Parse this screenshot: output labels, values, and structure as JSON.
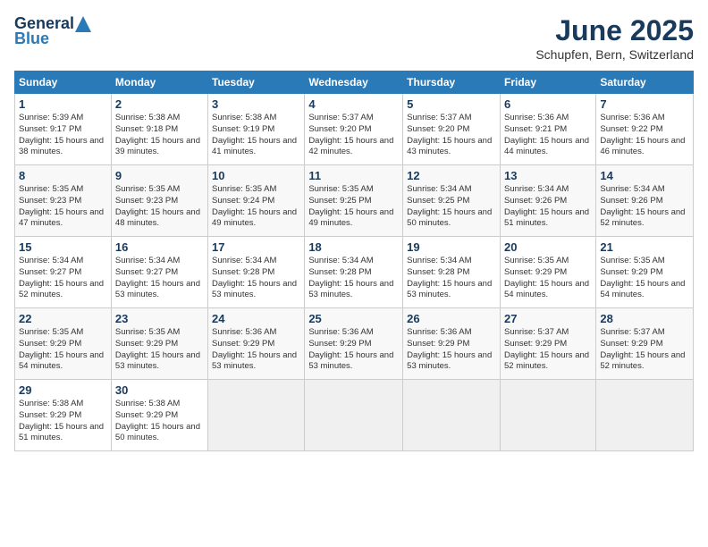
{
  "logo": {
    "general": "General",
    "blue": "Blue"
  },
  "title": "June 2025",
  "location": "Schupfen, Bern, Switzerland",
  "headers": [
    "Sunday",
    "Monday",
    "Tuesday",
    "Wednesday",
    "Thursday",
    "Friday",
    "Saturday"
  ],
  "weeks": [
    [
      {
        "day": "1",
        "sunrise": "5:39 AM",
        "sunset": "9:17 PM",
        "daylight": "15 hours and 38 minutes."
      },
      {
        "day": "2",
        "sunrise": "5:38 AM",
        "sunset": "9:18 PM",
        "daylight": "15 hours and 39 minutes."
      },
      {
        "day": "3",
        "sunrise": "5:38 AM",
        "sunset": "9:19 PM",
        "daylight": "15 hours and 41 minutes."
      },
      {
        "day": "4",
        "sunrise": "5:37 AM",
        "sunset": "9:20 PM",
        "daylight": "15 hours and 42 minutes."
      },
      {
        "day": "5",
        "sunrise": "5:37 AM",
        "sunset": "9:20 PM",
        "daylight": "15 hours and 43 minutes."
      },
      {
        "day": "6",
        "sunrise": "5:36 AM",
        "sunset": "9:21 PM",
        "daylight": "15 hours and 44 minutes."
      },
      {
        "day": "7",
        "sunrise": "5:36 AM",
        "sunset": "9:22 PM",
        "daylight": "15 hours and 46 minutes."
      }
    ],
    [
      {
        "day": "8",
        "sunrise": "5:35 AM",
        "sunset": "9:23 PM",
        "daylight": "15 hours and 47 minutes."
      },
      {
        "day": "9",
        "sunrise": "5:35 AM",
        "sunset": "9:23 PM",
        "daylight": "15 hours and 48 minutes."
      },
      {
        "day": "10",
        "sunrise": "5:35 AM",
        "sunset": "9:24 PM",
        "daylight": "15 hours and 49 minutes."
      },
      {
        "day": "11",
        "sunrise": "5:35 AM",
        "sunset": "9:25 PM",
        "daylight": "15 hours and 49 minutes."
      },
      {
        "day": "12",
        "sunrise": "5:34 AM",
        "sunset": "9:25 PM",
        "daylight": "15 hours and 50 minutes."
      },
      {
        "day": "13",
        "sunrise": "5:34 AM",
        "sunset": "9:26 PM",
        "daylight": "15 hours and 51 minutes."
      },
      {
        "day": "14",
        "sunrise": "5:34 AM",
        "sunset": "9:26 PM",
        "daylight": "15 hours and 52 minutes."
      }
    ],
    [
      {
        "day": "15",
        "sunrise": "5:34 AM",
        "sunset": "9:27 PM",
        "daylight": "15 hours and 52 minutes."
      },
      {
        "day": "16",
        "sunrise": "5:34 AM",
        "sunset": "9:27 PM",
        "daylight": "15 hours and 53 minutes."
      },
      {
        "day": "17",
        "sunrise": "5:34 AM",
        "sunset": "9:28 PM",
        "daylight": "15 hours and 53 minutes."
      },
      {
        "day": "18",
        "sunrise": "5:34 AM",
        "sunset": "9:28 PM",
        "daylight": "15 hours and 53 minutes."
      },
      {
        "day": "19",
        "sunrise": "5:34 AM",
        "sunset": "9:28 PM",
        "daylight": "15 hours and 53 minutes."
      },
      {
        "day": "20",
        "sunrise": "5:35 AM",
        "sunset": "9:29 PM",
        "daylight": "15 hours and 54 minutes."
      },
      {
        "day": "21",
        "sunrise": "5:35 AM",
        "sunset": "9:29 PM",
        "daylight": "15 hours and 54 minutes."
      }
    ],
    [
      {
        "day": "22",
        "sunrise": "5:35 AM",
        "sunset": "9:29 PM",
        "daylight": "15 hours and 54 minutes."
      },
      {
        "day": "23",
        "sunrise": "5:35 AM",
        "sunset": "9:29 PM",
        "daylight": "15 hours and 53 minutes."
      },
      {
        "day": "24",
        "sunrise": "5:36 AM",
        "sunset": "9:29 PM",
        "daylight": "15 hours and 53 minutes."
      },
      {
        "day": "25",
        "sunrise": "5:36 AM",
        "sunset": "9:29 PM",
        "daylight": "15 hours and 53 minutes."
      },
      {
        "day": "26",
        "sunrise": "5:36 AM",
        "sunset": "9:29 PM",
        "daylight": "15 hours and 53 minutes."
      },
      {
        "day": "27",
        "sunrise": "5:37 AM",
        "sunset": "9:29 PM",
        "daylight": "15 hours and 52 minutes."
      },
      {
        "day": "28",
        "sunrise": "5:37 AM",
        "sunset": "9:29 PM",
        "daylight": "15 hours and 52 minutes."
      }
    ],
    [
      {
        "day": "29",
        "sunrise": "5:38 AM",
        "sunset": "9:29 PM",
        "daylight": "15 hours and 51 minutes."
      },
      {
        "day": "30",
        "sunrise": "5:38 AM",
        "sunset": "9:29 PM",
        "daylight": "15 hours and 50 minutes."
      },
      null,
      null,
      null,
      null,
      null
    ]
  ]
}
